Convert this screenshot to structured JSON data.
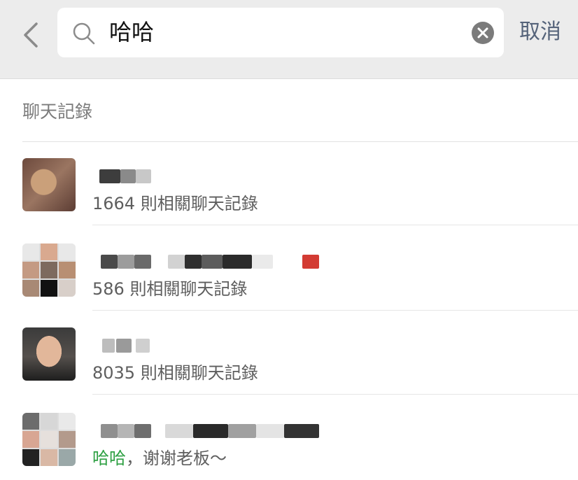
{
  "header": {
    "search_query": "哈哈",
    "cancel_label": "取消"
  },
  "section": {
    "title": "聊天記錄"
  },
  "results": [
    {
      "subtitle": "1664 則相關聊天記錄"
    },
    {
      "subtitle": "586 則相關聊天記錄"
    },
    {
      "subtitle": "8035 則相關聊天記錄"
    },
    {
      "subtitle_highlight": "哈哈",
      "subtitle_rest": "，谢谢老板～"
    }
  ],
  "colors": {
    "header_bg": "#ececec",
    "highlight": "#2ea043",
    "cancel": "#55637a",
    "blocked_red": "#d33b33"
  }
}
